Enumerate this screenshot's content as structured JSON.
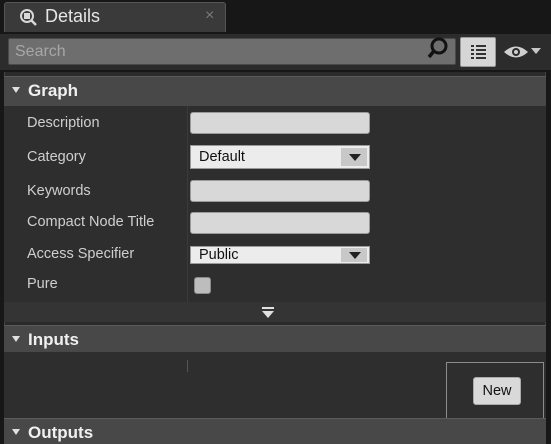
{
  "tab": {
    "title": "Details",
    "close": "×"
  },
  "search": {
    "placeholder": "Search"
  },
  "sections": {
    "graph": {
      "title": "Graph"
    },
    "inputs": {
      "title": "Inputs"
    },
    "outputs": {
      "title": "Outputs"
    }
  },
  "graph_rows": {
    "description": {
      "label": "Description",
      "value": ""
    },
    "category": {
      "label": "Category",
      "value": "Default"
    },
    "keywords": {
      "label": "Keywords",
      "value": ""
    },
    "compact_node_title": {
      "label": "Compact Node Title",
      "value": ""
    },
    "access_specifier": {
      "label": "Access Specifier",
      "value": "Public"
    },
    "pure": {
      "label": "Pure",
      "checked": false
    }
  },
  "inputs": {
    "new_label": "New"
  },
  "icons": {
    "tab": "details-icon",
    "search": "search-icon",
    "view": "list-view-icon",
    "eye": "eye-icon",
    "expand": "expand-arrow-icon"
  },
  "colors": {
    "header": "#484848",
    "panel": "#2e2e2e"
  }
}
